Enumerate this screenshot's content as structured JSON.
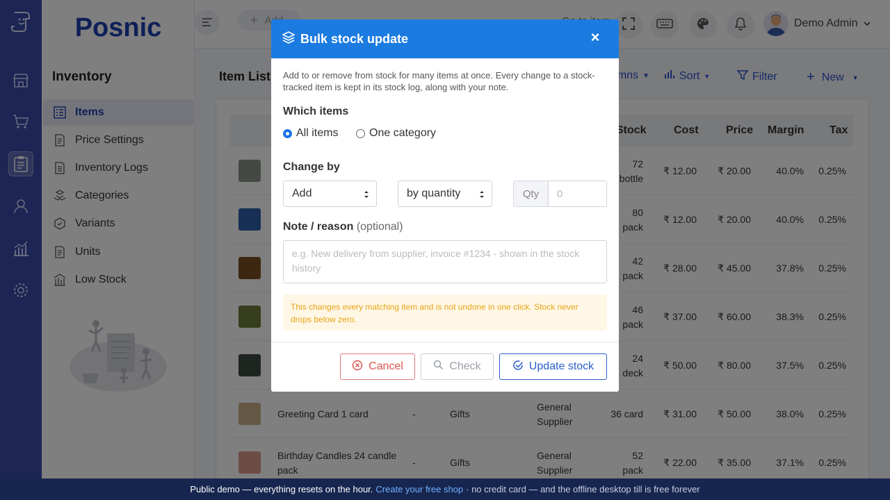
{
  "app": {
    "brand": "Posnic"
  },
  "sidebar": {
    "title": "Inventory",
    "items": [
      {
        "label": "Items",
        "icon": "items-icon",
        "active": true
      },
      {
        "label": "Price Settings",
        "icon": "price-icon"
      },
      {
        "label": "Inventory Logs",
        "icon": "logs-icon"
      },
      {
        "label": "Categories",
        "icon": "categories-icon"
      },
      {
        "label": "Variants",
        "icon": "variants-icon"
      },
      {
        "label": "Units",
        "icon": "units-icon"
      },
      {
        "label": "Low Stock",
        "icon": "low-stock-icon"
      }
    ]
  },
  "topbar": {
    "add_label": "Add",
    "search_text": "Go to item",
    "user_name": "Demo Admin"
  },
  "content": {
    "title": "Item List",
    "actions": {
      "columns": "Columns",
      "sort": "Sort",
      "filter": "Filter",
      "new": "New"
    },
    "columns": {
      "stock": "Stock",
      "cost": "Cost",
      "price": "Price",
      "margin": "Margin",
      "tax": "Tax"
    },
    "rows": [
      {
        "stock1": "72",
        "stock2": "bottle",
        "cost": "₹ 12.00",
        "price": "₹ 20.00",
        "margin": "40.0%",
        "tax": "0.25%"
      },
      {
        "stock1": "80",
        "stock2": "pack",
        "cost": "₹ 12.00",
        "price": "₹ 20.00",
        "margin": "40.0%",
        "tax": "0.25%"
      },
      {
        "stock1": "42",
        "stock2": "pack",
        "cost": "₹ 28.00",
        "price": "₹ 45.00",
        "margin": "37.8%",
        "tax": "0.25%"
      },
      {
        "stock1": "46",
        "stock2": "pack",
        "cost": "₹ 37.00",
        "price": "₹ 60.00",
        "margin": "38.3%",
        "tax": "0.25%"
      },
      {
        "stock1": "24",
        "stock2": "deck",
        "cost": "₹ 50.00",
        "price": "₹ 80.00",
        "margin": "37.5%",
        "tax": "0.25%"
      },
      {
        "name": "Greeting Card 1 card",
        "code": "-",
        "category": "Gifts",
        "supplier1": "General",
        "supplier2": "Supplier",
        "stock1": "36 card",
        "stock2": "",
        "cost": "₹ 31.00",
        "price": "₹ 50.00",
        "margin": "38.0%",
        "tax": "0.25%"
      },
      {
        "name": "Birthday Candles 24 candle",
        "name2": "pack",
        "code": "-",
        "category": "Gifts",
        "supplier1": "General",
        "supplier2": "Supplier",
        "stock1": "52",
        "stock2": "pack",
        "cost": "₹ 22.00",
        "price": "₹ 35.00",
        "margin": "37.1%",
        "tax": "0.25%"
      }
    ]
  },
  "modal": {
    "title": "Bulk stock update",
    "description": "Add to or remove from stock for many items at once. Every change to a stock-tracked item is kept in its stock log, along with your note.",
    "which_items_label": "Which items",
    "radio_all": "All items",
    "radio_category": "One category",
    "change_by_label": "Change by",
    "action_value": "Add",
    "mode_value": "by quantity",
    "qty_label": "Qty",
    "qty_placeholder": "0",
    "note_label": "Note / reason",
    "note_optional": "(optional)",
    "note_placeholder": "e.g. New delivery from supplier, invoice #1234 - shown in the stock history",
    "warning": "This changes every matching item and is not undone in one click. Stock never drops below zero.",
    "cancel": "Cancel",
    "check": "Check",
    "update": "Update stock"
  },
  "banner": {
    "text_before": "Public demo — everything resets on the hour.",
    "link": "Create your free shop",
    "text_after": "· no credit card — and the offline desktop till is free forever"
  },
  "colors": {
    "rail": "#3b4aa8",
    "modal_header": "#1c7be0",
    "brand": "#1f3fb0",
    "banner": "#17264f"
  }
}
